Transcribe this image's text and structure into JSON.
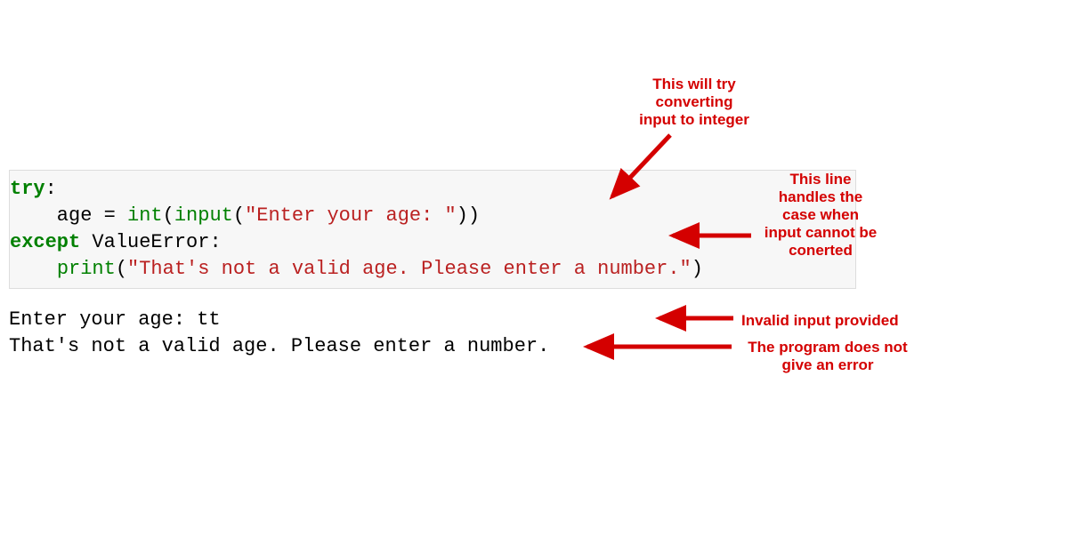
{
  "code": {
    "line1_kw": "try",
    "line1_colon": ":",
    "line2_indent": "    age = ",
    "line2_int": "int",
    "line2_open": "(",
    "line2_input": "input",
    "line2_open2": "(",
    "line2_str": "\"Enter your age: \"",
    "line2_close": "))",
    "line3_kw": "except",
    "line3_err": " ValueError:",
    "line4_indent": "    ",
    "line4_print": "print",
    "line4_open": "(",
    "line4_str": "\"That's not a valid age. Please enter a number.\"",
    "line4_close": ")"
  },
  "output": {
    "line1": "Enter your age: tt",
    "line2": "That's not a valid age. Please enter a number."
  },
  "annotations": {
    "top": "This will try\nconverting\ninput to integer",
    "right1": "This line\nhandles the\ncase when\ninput cannot be\nconerted",
    "right2": "Invalid input provided",
    "right3": "The program does not\ngive an error"
  },
  "colors": {
    "annotation": "#d40000",
    "keyword": "#008000",
    "string": "#ba2121"
  }
}
